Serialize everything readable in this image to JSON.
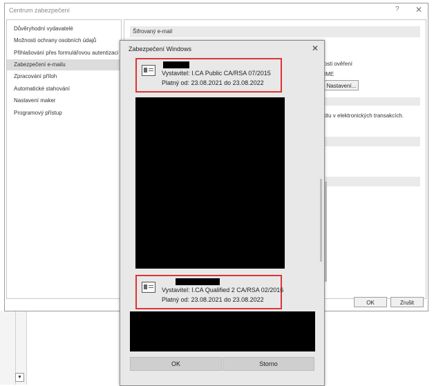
{
  "trust_center": {
    "title": "Centrum zabezpečení",
    "help_label": "?",
    "close_label": "✕",
    "nav_items": [
      "Důvěryhodní vydavatelé",
      "Možnosti ochrany osobních údajů",
      "Přihlašování přes formulářovou autentizaci",
      "Zabezpečení e-mailu",
      "Zpracování příloh",
      "Automatické stahování",
      "Nastavení maker",
      "Programový přístup"
    ],
    "selected_nav_index": 3,
    "content": {
      "encrypted_section_title": "Šifrovaný e-mail",
      "fragment_verification": "tnosti ověření",
      "fragment_mime": "IME",
      "settings_button_label": "Nastavení...",
      "fragment_transactions": "entitu v elektronických transakcích."
    },
    "ok_label": "OK",
    "cancel_label": "Zrušit"
  },
  "dialog": {
    "title": "Zabezpečení Windows",
    "close_label": "✕",
    "certificates": [
      {
        "issuer": "Vystavitel: I.CA Public CA/RSA 07/2015",
        "valid": "Platný od: 23.08.2021 do 23.08.2022"
      },
      {
        "issuer": "Vystavitel: I.CA Qualified 2 CA/RSA 02/2016",
        "valid": "Platný od: 23.08.2021 do 23.08.2022"
      }
    ],
    "ok_label": "OK",
    "cancel_label": "Storno"
  },
  "colors": {
    "highlight_border": "#dd3333",
    "redaction": "#000000",
    "dialog_background": "#e8e8e8"
  }
}
